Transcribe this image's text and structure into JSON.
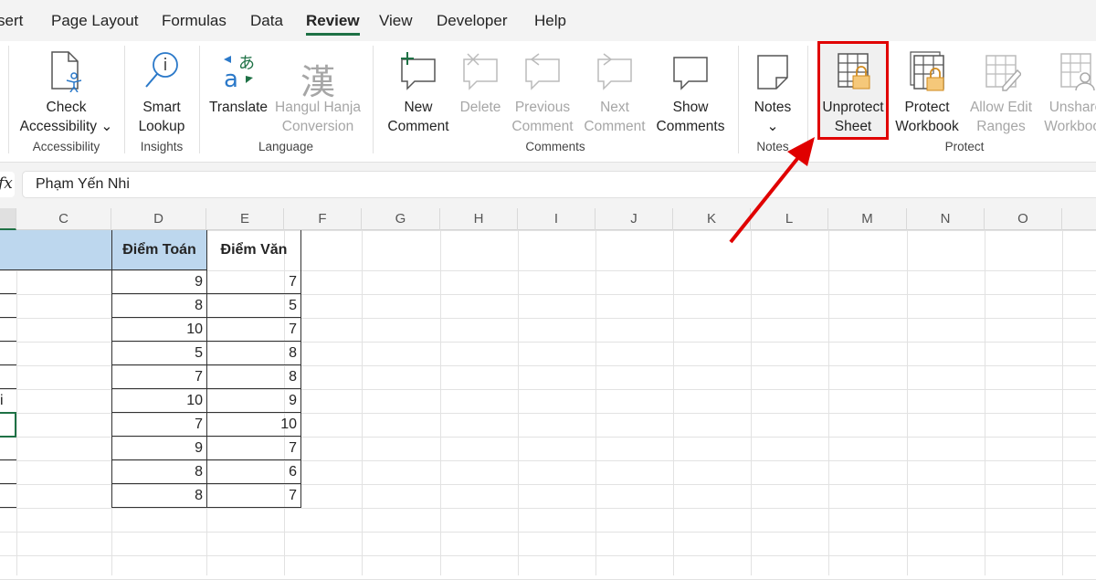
{
  "tabs": [
    "sert",
    "Page Layout",
    "Formulas",
    "Data",
    "Review",
    "View",
    "Developer",
    "Help"
  ],
  "active_tab": "Review",
  "ribbon": {
    "check_accessibility": "Check",
    "check_accessibility2": "Accessibility ⌄",
    "smart": "Smart",
    "lookup": "Lookup",
    "translate": "Translate",
    "hangul": "Hangul Hanja",
    "conversion": "Conversion",
    "new": "New",
    "new2": "Comment",
    "delete": "Delete",
    "previous": "Previous",
    "previous2": "Comment",
    "next": "Next",
    "next2": "Comment",
    "show": "Show",
    "show2": "Comments",
    "notes": "Notes",
    "notes_chev": "⌄",
    "unprotect": "Unprotect",
    "unprotect2": "Sheet",
    "protect": "Protect",
    "protect2": "Workbook",
    "allow": "Allow Edit",
    "allow2": "Ranges",
    "unshare": "Unshare",
    "unshare2": "Workbook",
    "groups": {
      "accessibility": "Accessibility",
      "insights": "Insights",
      "language": "Language",
      "comments": "Comments",
      "notes": "Notes",
      "protect": "Protect"
    }
  },
  "formula": {
    "fx": "fx",
    "value": "Phạm Yến Nhi"
  },
  "columns": [
    "C",
    "D",
    "E",
    "F",
    "G",
    "H",
    "I",
    "J",
    "K",
    "L",
    "M",
    "N",
    "O"
  ],
  "table": {
    "headers": [
      "Điểm Toán",
      "Điểm Văn"
    ],
    "rows": [
      [
        9,
        7
      ],
      [
        8,
        5
      ],
      [
        10,
        7
      ],
      [
        5,
        8
      ],
      [
        7,
        8
      ],
      [
        10,
        9
      ],
      [
        7,
        10
      ],
      [
        9,
        7
      ],
      [
        8,
        6
      ],
      [
        8,
        7
      ]
    ],
    "b_fragment": "i"
  },
  "colors": {
    "accent": "#1e7145",
    "header_fill": "#bdd7ee",
    "highlight": "#e00000"
  }
}
